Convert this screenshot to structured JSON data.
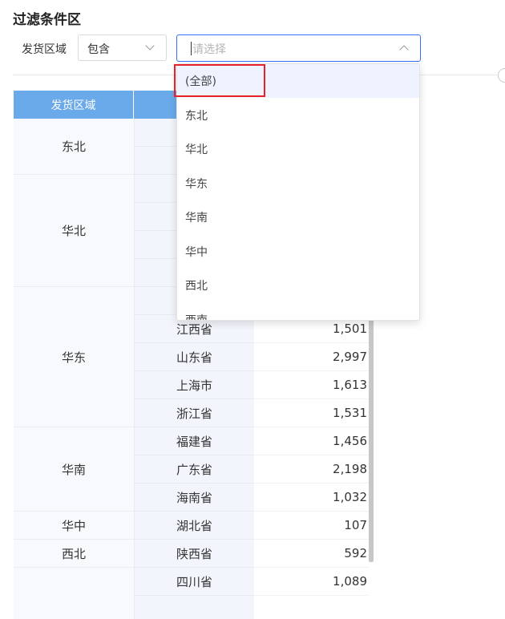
{
  "filter": {
    "section_title": "过滤条件区",
    "field_label": "发货区域",
    "operator_value": "包含",
    "value_placeholder": "请选择",
    "dropdown_options": [
      "(全部)",
      "东北",
      "华北",
      "华东",
      "华南",
      "华中",
      "西北",
      "西南"
    ]
  },
  "table": {
    "headers": [
      "发货区域",
      "",
      ""
    ],
    "regions": [
      {
        "name": "东北",
        "rows": 2
      },
      {
        "name": "华北",
        "rows": 4
      },
      {
        "name": "华东",
        "rows": 5
      },
      {
        "name": "华南",
        "rows": 3
      },
      {
        "name": "华中",
        "rows": 1
      },
      {
        "name": "西北",
        "rows": 1
      },
      {
        "name": "",
        "rows": 2
      }
    ],
    "rows": [
      {
        "province": "",
        "value": ""
      },
      {
        "province": "",
        "value": ""
      },
      {
        "province": "",
        "value": ""
      },
      {
        "province": "",
        "value": ""
      },
      {
        "province": "",
        "value": ""
      },
      {
        "province": "",
        "value": ""
      },
      {
        "province": "",
        "value": ""
      },
      {
        "province": "江西省",
        "value": "1,501"
      },
      {
        "province": "山东省",
        "value": "2,997"
      },
      {
        "province": "上海市",
        "value": "1,613"
      },
      {
        "province": "浙江省",
        "value": "1,531"
      },
      {
        "province": "福建省",
        "value": "1,456"
      },
      {
        "province": "广东省",
        "value": "2,198"
      },
      {
        "province": "海南省",
        "value": "1,032"
      },
      {
        "province": "湖北省",
        "value": "107"
      },
      {
        "province": "陕西省",
        "value": "592"
      },
      {
        "province": "四川省",
        "value": "1,089"
      },
      {
        "province": "",
        "value": ""
      }
    ]
  }
}
